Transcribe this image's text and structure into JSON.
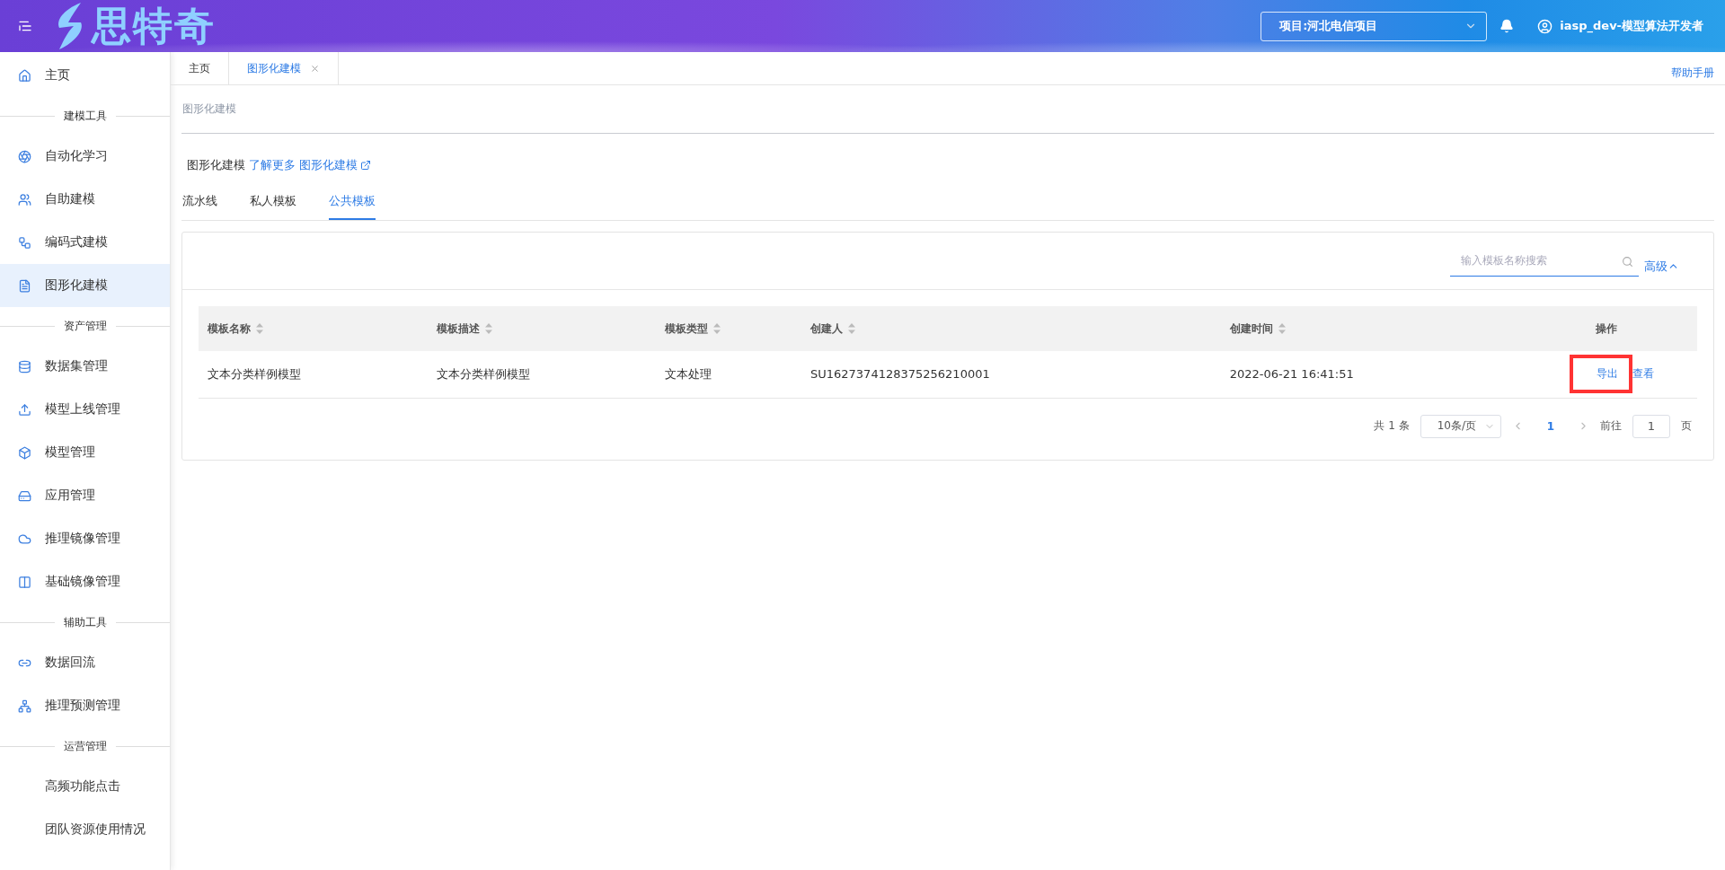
{
  "header": {
    "logo_text": "思特奇",
    "project_select": {
      "value": "项目:河北电信项目"
    },
    "user": "iasp_dev-模型算法开发者"
  },
  "sidebar": {
    "items": [
      {
        "kind": "item",
        "label": "主页",
        "selected": false
      },
      {
        "kind": "section",
        "label": "建模工具"
      },
      {
        "kind": "item",
        "label": "自动化学习",
        "selected": false
      },
      {
        "kind": "item",
        "label": "自助建模",
        "selected": false
      },
      {
        "kind": "item",
        "label": "编码式建模",
        "selected": false
      },
      {
        "kind": "item",
        "label": "图形化建模",
        "selected": true
      },
      {
        "kind": "section",
        "label": "资产管理"
      },
      {
        "kind": "item",
        "label": "数据集管理",
        "selected": false
      },
      {
        "kind": "item",
        "label": "模型上线管理",
        "selected": false
      },
      {
        "kind": "item",
        "label": "模型管理",
        "selected": false
      },
      {
        "kind": "item",
        "label": "应用管理",
        "selected": false
      },
      {
        "kind": "item",
        "label": "推理镜像管理",
        "selected": false
      },
      {
        "kind": "item",
        "label": "基础镜像管理",
        "selected": false
      },
      {
        "kind": "section",
        "label": "辅助工具"
      },
      {
        "kind": "item",
        "label": "数据回流",
        "selected": false
      },
      {
        "kind": "item",
        "label": "推理预测管理",
        "selected": false
      },
      {
        "kind": "section",
        "label": "运营管理"
      },
      {
        "kind": "item",
        "label": "高频功能点击",
        "selected": false
      },
      {
        "kind": "item",
        "label": "团队资源使用情况",
        "selected": false
      }
    ]
  },
  "page_tabs": [
    {
      "label": "主页",
      "selected": false
    },
    {
      "label": "图形化建模",
      "selected": true
    }
  ],
  "help_link": "帮助手册",
  "breadcrumb": "图形化建模",
  "intro": {
    "title": "图形化建模",
    "link": "了解更多 图形化建模"
  },
  "tabs": [
    {
      "label": "流水线",
      "selected": false
    },
    {
      "label": "私人模板",
      "selected": false
    },
    {
      "label": "公共模板",
      "selected": true
    }
  ],
  "search": {
    "placeholder": "输入模板名称搜索"
  },
  "advanced": "高级",
  "table": {
    "columns": [
      "模板名称",
      "模板描述",
      "模板类型",
      "创建人",
      "创建时间",
      "操作"
    ],
    "rows": [
      {
        "cells": [
          "文本分类样例模型",
          "文本分类样例模型",
          "文本处理",
          "SU1627374128375256210001",
          "2022-06-21 16:41:51"
        ],
        "actions": [
          {
            "label": "导出",
            "highlighted": true
          },
          {
            "label": "查看",
            "highlighted": false
          }
        ]
      }
    ]
  },
  "pagination": {
    "total": "共 1 条",
    "page_size": "10条/页",
    "pages": [
      {
        "label": "1",
        "selected": true
      }
    ],
    "goto_label": "前往",
    "goto_value": "1",
    "page_suffix": "页"
  }
}
